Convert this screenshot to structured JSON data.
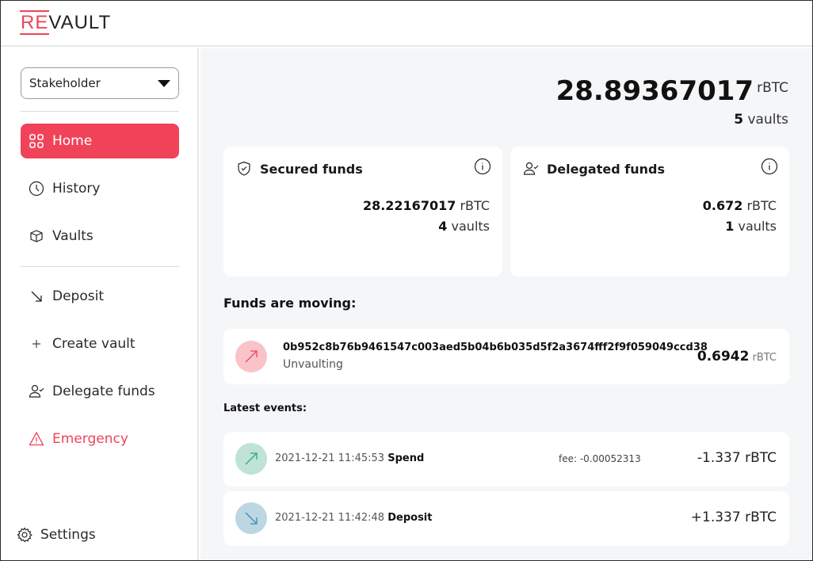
{
  "app": {
    "logo_accent": "RE",
    "logo_rest": "VAULT"
  },
  "colors": {
    "accent": "#f04359",
    "spend_circle": "#bfe3d6",
    "spend_arrow": "#2ea77a",
    "deposit_circle": "#bcd6e2",
    "deposit_arrow": "#3a8fb7",
    "unvault_circle": "#f9c3c9",
    "unvault_arrow": "#f04359"
  },
  "sidebar": {
    "role_select": {
      "value": "Stakeholder"
    },
    "items": [
      {
        "label": "Home",
        "icon": "grid-icon",
        "active": true
      },
      {
        "label": "History",
        "icon": "clock-icon"
      },
      {
        "label": "Vaults",
        "icon": "box-icon"
      },
      {
        "label": "Deposit",
        "icon": "arrow-down-right-icon"
      },
      {
        "label": "Create vault",
        "icon": "plus-icon"
      },
      {
        "label": "Delegate funds",
        "icon": "user-check-icon"
      },
      {
        "label": "Emergency",
        "icon": "warning-icon"
      }
    ],
    "settings": {
      "label": "Settings",
      "icon": "gear-icon"
    }
  },
  "overview": {
    "total_amount": "28.89367017",
    "unit": "rBTC",
    "vault_count": "5",
    "vaults_label": "vaults"
  },
  "cards": {
    "secured": {
      "title": "Secured funds",
      "amount": "28.22167017",
      "unit": "rBTC",
      "vault_count": "4",
      "vaults_label": "vaults"
    },
    "delegated": {
      "title": "Delegated funds",
      "amount": "0.672",
      "unit": "rBTC",
      "vault_count": "1",
      "vaults_label": "vaults"
    }
  },
  "moving": {
    "title": "Funds are moving:",
    "items": [
      {
        "txid": "0b952c8b76b9461547c003aed5b04b6b035d5f2a3674fff2f9f059049ccd38",
        "status": "Unvaulting",
        "amount": "0.6942",
        "unit": "rBTC"
      }
    ]
  },
  "events": {
    "title": "Latest events:",
    "items": [
      {
        "date": "2021-12-21 11:45:53",
        "type": "Spend",
        "fee": "fee: -0.00052313",
        "amount": "-1.337 rBTC"
      },
      {
        "date": "2021-12-21 11:42:48",
        "type": "Deposit",
        "fee": "",
        "amount": "+1.337 rBTC"
      }
    ]
  }
}
